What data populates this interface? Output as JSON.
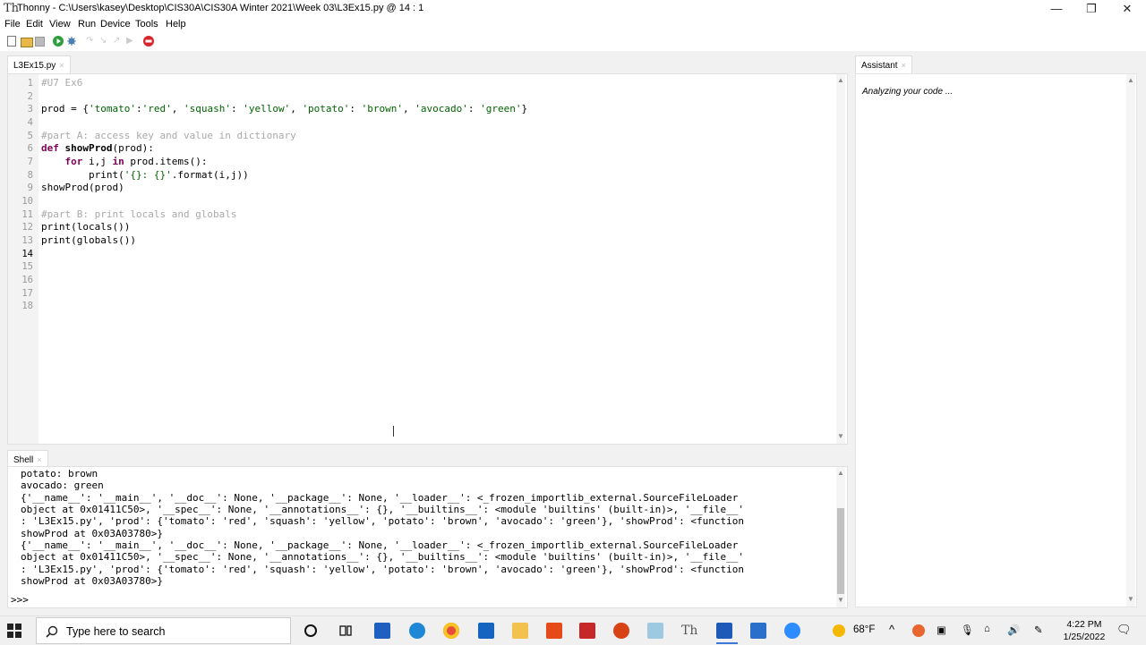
{
  "window": {
    "title": "Thonny  -  C:\\Users\\kasey\\Desktop\\CIS30A\\CIS30A Winter 2021\\Week 03\\L3Ex15.py  @  14 : 1",
    "minimize": "—",
    "maximize": "❐",
    "close": "✕"
  },
  "menu": [
    "File",
    "Edit",
    "View",
    "Run",
    "Device",
    "Tools",
    "Help"
  ],
  "editor": {
    "tab_label": "L3Ex15.py",
    "line_numbers": [
      "1",
      "2",
      "3",
      "4",
      "5",
      "6",
      "7",
      "8",
      "9",
      "10",
      "11",
      "12",
      "13",
      "14",
      "15",
      "16",
      "17",
      "18"
    ],
    "current_line": 14
  },
  "assistant": {
    "tab_label": "Assistant",
    "message": "Analyzing your code ..."
  },
  "shell": {
    "tab_label": "Shell",
    "lines": [
      "potato: brown",
      "avocado: green",
      "{'__name__': '__main__', '__doc__': None, '__package__': None, '__loader__': <_frozen_importlib_external.SourceFileLoader",
      "object at 0x01411C50>, '__spec__': None, '__annotations__': {}, '__builtins__': <module 'builtins' (built-in)>, '__file__'",
      ": 'L3Ex15.py', 'prod': {'tomato': 'red', 'squash': 'yellow', 'potato': 'brown', 'avocado': 'green'}, 'showProd': <function",
      "showProd at 0x03A03780>}",
      "{'__name__': '__main__', '__doc__': None, '__package__': None, '__loader__': <_frozen_importlib_external.SourceFileLoader",
      "object at 0x01411C50>, '__spec__': None, '__annotations__': {}, '__builtins__': <module 'builtins' (built-in)>, '__file__'",
      ": 'L3Ex15.py', 'prod': {'tomato': 'red', 'squash': 'yellow', 'potato': 'brown', 'avocado': 'green'}, 'showProd': <function",
      "showProd at 0x03A03780>}"
    ],
    "prompt": ">>>"
  },
  "taskbar": {
    "search_placeholder": "Type here to search",
    "weather": "68°F",
    "time": "4:22 PM",
    "date": "1/25/2022"
  },
  "colors": {
    "keyword": "#7f0055",
    "string": "#006400",
    "comment": "#a9a9a9",
    "pane_background": "#f1f1f1"
  }
}
